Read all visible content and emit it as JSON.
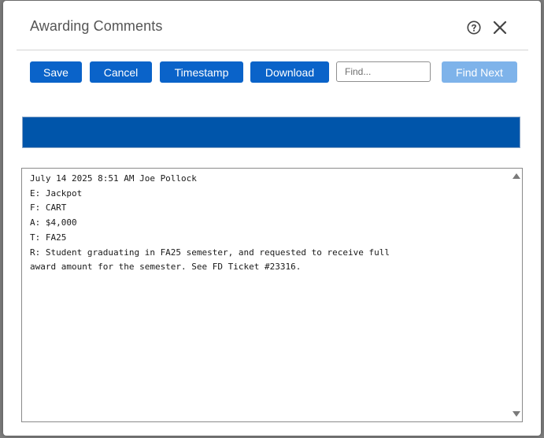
{
  "dialog": {
    "title": "Awarding Comments",
    "help_icon": "question-circle-icon",
    "close_icon": "close-x-icon"
  },
  "toolbar": {
    "save_label": "Save",
    "cancel_label": "Cancel",
    "timestamp_label": "Timestamp",
    "download_label": "Download",
    "find_placeholder": "Find...",
    "find_value": "",
    "find_next_label": "Find Next"
  },
  "banner": {
    "color": "#0055aa"
  },
  "comments": {
    "lines": [
      "July 14 2025 8:51 AM Joe Pollock",
      "E: Jackpot",
      "F: CART",
      "A: $4,000",
      "T: FA25",
      "R: Student graduating in FA25 semester, and requested to receive full",
      "award amount for the semester. See FD Ticket #23316."
    ]
  },
  "colors": {
    "primary_button": "#0a63c9",
    "disabled_button": "#7eb3ea",
    "title_text": "#555555"
  }
}
